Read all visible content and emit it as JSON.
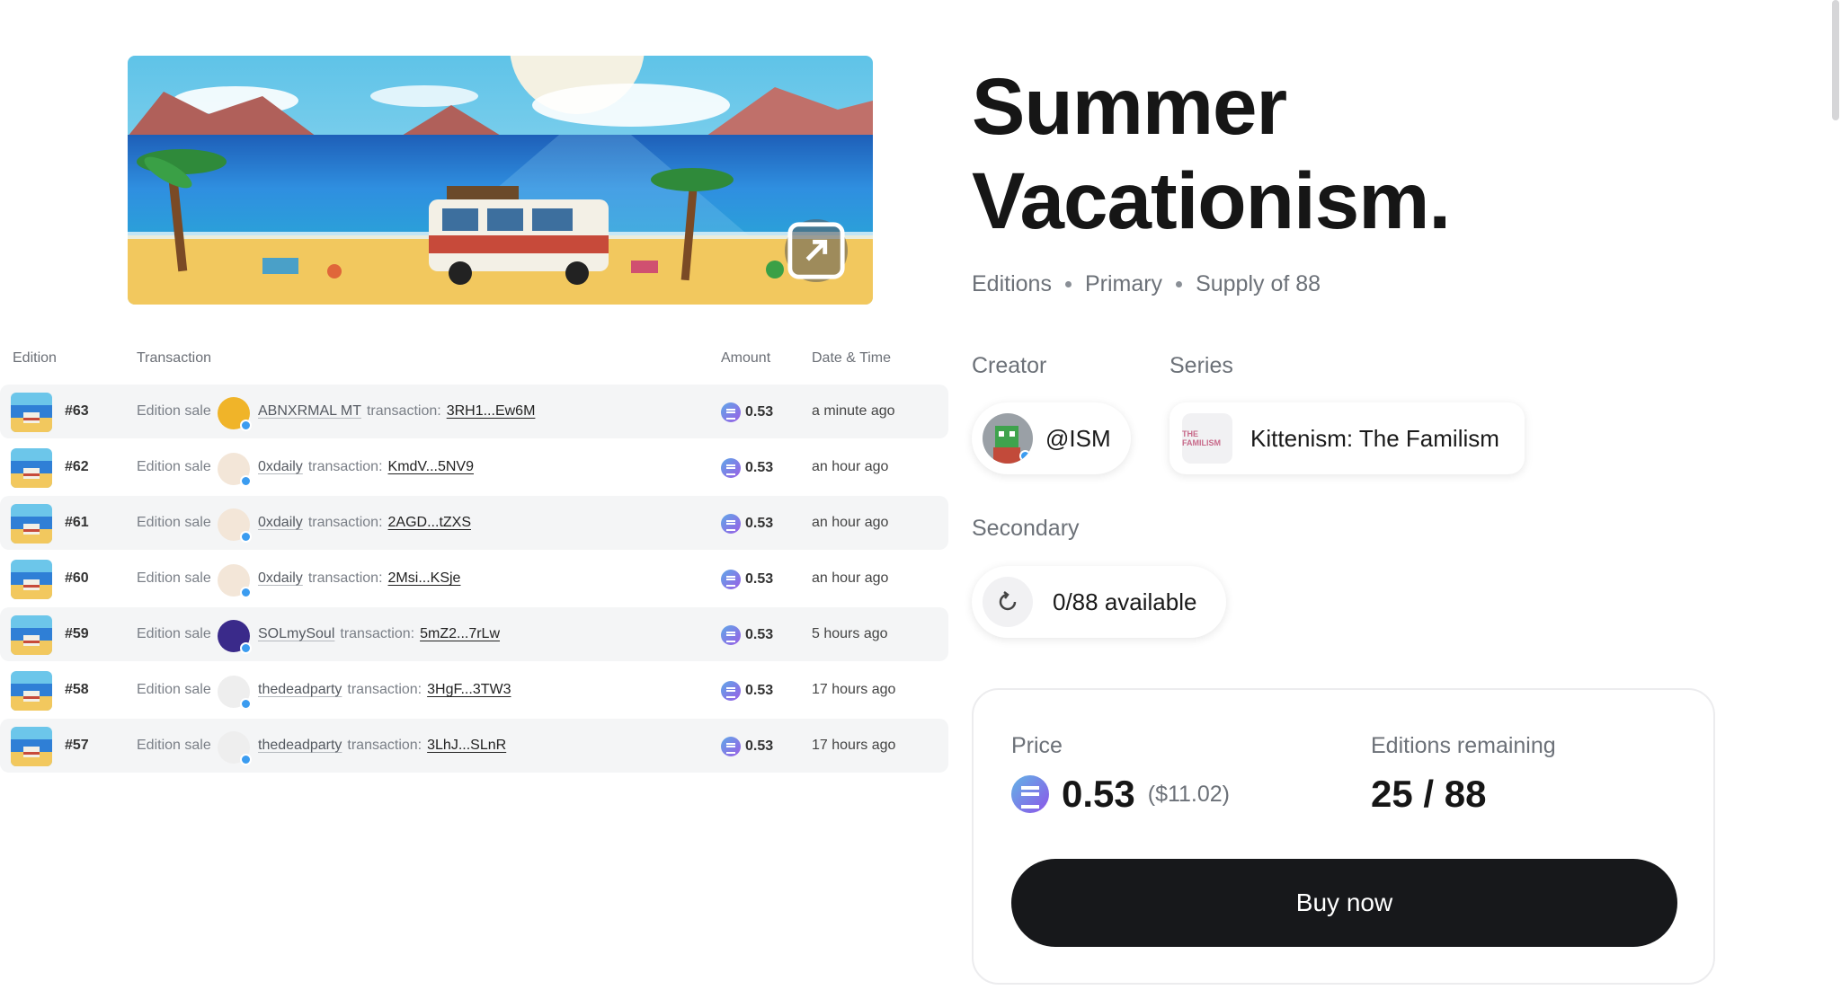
{
  "artwork": {
    "expand_icon": "expand-icon"
  },
  "table": {
    "headers": {
      "edition": "Edition",
      "transaction": "Transaction",
      "amount": "Amount",
      "datetime": "Date & Time"
    },
    "rows": [
      {
        "edition": "#63",
        "sale": "Edition sale",
        "buyer": "ABNXRMAL MT",
        "tx_word": "transaction:",
        "hash": "3RH1...Ew6M",
        "amount": "0.53",
        "time": "a minute ago",
        "avatar_color": "#f0b429"
      },
      {
        "edition": "#62",
        "sale": "Edition sale",
        "buyer": "0xdaily",
        "tx_word": "transaction:",
        "hash": "KmdV...5NV9",
        "amount": "0.53",
        "time": "an hour ago",
        "avatar_color": "#f3e6d8"
      },
      {
        "edition": "#61",
        "sale": "Edition sale",
        "buyer": "0xdaily",
        "tx_word": "transaction:",
        "hash": "2AGD...tZXS",
        "amount": "0.53",
        "time": "an hour ago",
        "avatar_color": "#f3e6d8"
      },
      {
        "edition": "#60",
        "sale": "Edition sale",
        "buyer": "0xdaily",
        "tx_word": "transaction:",
        "hash": "2Msi...KSje",
        "amount": "0.53",
        "time": "an hour ago",
        "avatar_color": "#f3e6d8"
      },
      {
        "edition": "#59",
        "sale": "Edition sale",
        "buyer": "SOLmySoul",
        "tx_word": "transaction:",
        "hash": "5mZ2...7rLw",
        "amount": "0.53",
        "time": "5 hours ago",
        "avatar_color": "#3a2a8a"
      },
      {
        "edition": "#58",
        "sale": "Edition sale",
        "buyer": "thedeadparty",
        "tx_word": "transaction:",
        "hash": "3HgF...3TW3",
        "amount": "0.53",
        "time": "17 hours ago",
        "avatar_color": "#eeeeee"
      },
      {
        "edition": "#57",
        "sale": "Edition sale",
        "buyer": "thedeadparty",
        "tx_word": "transaction:",
        "hash": "3LhJ...SLnR",
        "amount": "0.53",
        "time": "17 hours ago",
        "avatar_color": "#eeeeee"
      }
    ]
  },
  "title": {
    "line1": "Summer",
    "line2": "Vacationism."
  },
  "meta": {
    "type": "Editions",
    "market": "Primary",
    "supply": "Supply of 88"
  },
  "creator": {
    "label": "Creator",
    "handle": "@ISM"
  },
  "series": {
    "label": "Series",
    "name": "Kittenism: The Familism",
    "thumb_text": "THE FAMILISM"
  },
  "secondary": {
    "label": "Secondary",
    "available": "0/88 available",
    "icon": "refresh-icon"
  },
  "price_card": {
    "price_label": "Price",
    "price": "0.53",
    "price_usd": "($11.02)",
    "remaining_label": "Editions remaining",
    "remaining": "25 / 88",
    "buy_label": "Buy now"
  },
  "colors": {
    "accent_dark": "#17181b",
    "sol_from": "#5fa8e8",
    "sol_to": "#9b5de5"
  }
}
